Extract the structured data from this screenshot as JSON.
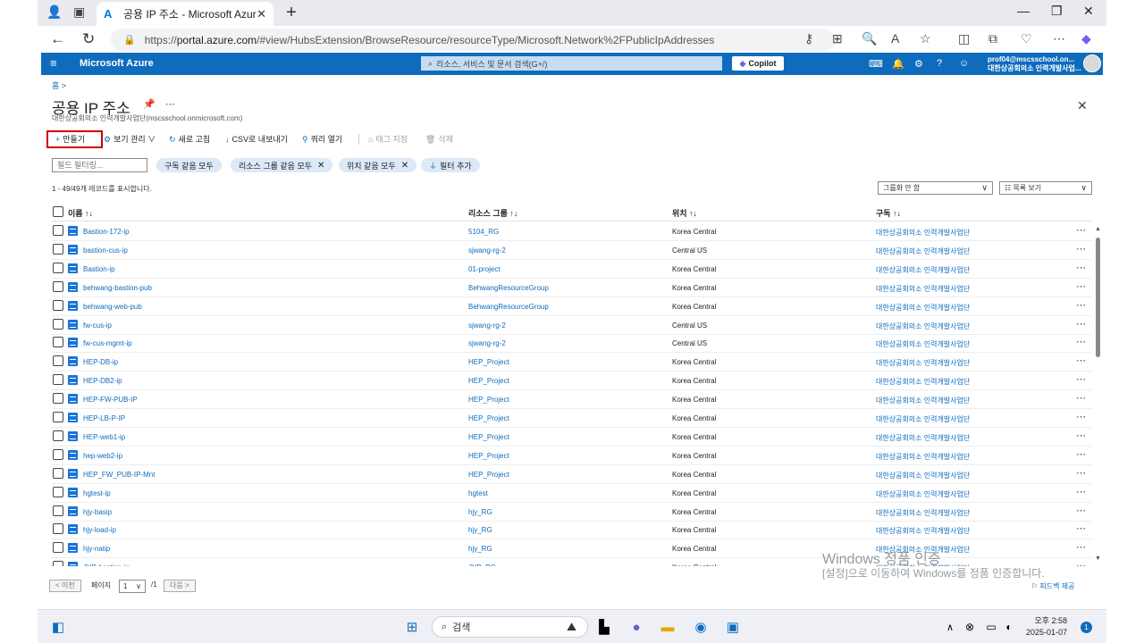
{
  "browser": {
    "tab_title": "공용 IP 주소 - Microsoft Azure",
    "url_prefix": "https://",
    "url_host": "portal.azure.com",
    "url_rest": "/#view/HubsExtension/BrowseResource/resourceType/Microsoft.Network%2FPublicIpAddresses"
  },
  "azure": {
    "brand": "Microsoft Azure",
    "search_placeholder": "리소스, 서비스 및 문서 검색(G+/)",
    "copilot": "Copilot",
    "user_email": "prof04@mscsschool.on...",
    "user_org": "대한상공회의소 인력개발사업..."
  },
  "page": {
    "breadcrumb": "홈 >",
    "title": "공용 IP 주소",
    "subtitle": "대한상공회의소 인력개발사업단(mscsschool.onmicrosoft.com)"
  },
  "toolbar": {
    "create": "만들기",
    "view_manage": "보기 관리",
    "refresh": "새로 고침",
    "export_csv": "CSV로 내보내기",
    "open_query": "쿼리 열기",
    "assign_tags": "태그 지정",
    "delete": "삭제"
  },
  "filters": {
    "field_filter_placeholder": "필드 필터링...",
    "subscription": "구독 같음 모두",
    "resource_group": "리소스 그룹 같음 모두",
    "location": "위치 같음 모두",
    "add_filter": "필터 추가"
  },
  "records": {
    "info": "1 - 49/49개 레코드를 표시합니다.",
    "grouping": "그룹화 안 함",
    "view_mode": "목록 보기"
  },
  "table": {
    "headers": {
      "name": "이름 ↑↓",
      "resource_group": "리소스 그룹 ↑↓",
      "location": "위치 ↑↓",
      "subscription": "구독 ↑↓"
    },
    "rows": [
      {
        "name": "Bastion-172-ip",
        "rg": "5104_RG",
        "loc": "Korea Central",
        "sub": "대한상공회의소 인력개발사업단"
      },
      {
        "name": "bastion-cus-ip",
        "rg": "sjwang-rg-2",
        "loc": "Central US",
        "sub": "대한상공회의소 인력개발사업단"
      },
      {
        "name": "Bastion-ip",
        "rg": "01-project",
        "loc": "Korea Central",
        "sub": "대한상공회의소 인력개발사업단"
      },
      {
        "name": "behwang-bastion-pub",
        "rg": "BehwangResourceGroup",
        "loc": "Korea Central",
        "sub": "대한상공회의소 인력개발사업단"
      },
      {
        "name": "behwang-web-pub",
        "rg": "BehwangResourceGroup",
        "loc": "Korea Central",
        "sub": "대한상공회의소 인력개발사업단"
      },
      {
        "name": "fw-cus-ip",
        "rg": "sjwang-rg-2",
        "loc": "Central US",
        "sub": "대한상공회의소 인력개발사업단"
      },
      {
        "name": "fw-cus-mgmt-ip",
        "rg": "sjwang-rg-2",
        "loc": "Central US",
        "sub": "대한상공회의소 인력개발사업단"
      },
      {
        "name": "HEP-DB-ip",
        "rg": "HEP_Project",
        "loc": "Korea Central",
        "sub": "대한상공회의소 인력개발사업단"
      },
      {
        "name": "HEP-DB2-ip",
        "rg": "HEP_Project",
        "loc": "Korea Central",
        "sub": "대한상공회의소 인력개발사업단"
      },
      {
        "name": "HEP-FW-PUB-IP",
        "rg": "HEP_Project",
        "loc": "Korea Central",
        "sub": "대한상공회의소 인력개발사업단"
      },
      {
        "name": "HEP-LB-P-IP",
        "rg": "HEP_Project",
        "loc": "Korea Central",
        "sub": "대한상공회의소 인력개발사업단"
      },
      {
        "name": "HEP-web1-ip",
        "rg": "HEP_Project",
        "loc": "Korea Central",
        "sub": "대한상공회의소 인력개발사업단"
      },
      {
        "name": "hep-web2-ip",
        "rg": "HEP_Project",
        "loc": "Korea Central",
        "sub": "대한상공회의소 인력개발사업단"
      },
      {
        "name": "HEP_FW_PUB-IP-Mnt",
        "rg": "HEP_Project",
        "loc": "Korea Central",
        "sub": "대한상공회의소 인력개발사업단"
      },
      {
        "name": "hgtest-ip",
        "rg": "hgtest",
        "loc": "Korea Central",
        "sub": "대한상공회의소 인력개발사업단"
      },
      {
        "name": "hjy-basip",
        "rg": "hjy_RG",
        "loc": "Korea Central",
        "sub": "대한상공회의소 인력개발사업단"
      },
      {
        "name": "hjy-load-ip",
        "rg": "hjy_RG",
        "loc": "Korea Central",
        "sub": "대한상공회의소 인력개발사업단"
      },
      {
        "name": "hjy-natip",
        "rg": "hjy_RG",
        "loc": "Korea Central",
        "sub": "대한상공회의소 인력개발사업단"
      },
      {
        "name": "JYP-bastion-ip",
        "rg": "JYP_RG",
        "loc": "Korea Central",
        "sub": "대한상공회의소 인력개발사업단"
      }
    ]
  },
  "pager": {
    "prev": "< 이전",
    "page_label": "페이지",
    "page_value": "1",
    "page_total": "/1",
    "next": "다음 >",
    "feedback": "피드백 제공"
  },
  "watermark": {
    "line1": "Windows 정품 인증",
    "line2": "[설정]으로 이동하여 Windows를 정품 인증합니다."
  },
  "taskbar": {
    "search": "검색",
    "time": "오후 2:58",
    "date": "2025-01-07",
    "notification_count": "1"
  }
}
